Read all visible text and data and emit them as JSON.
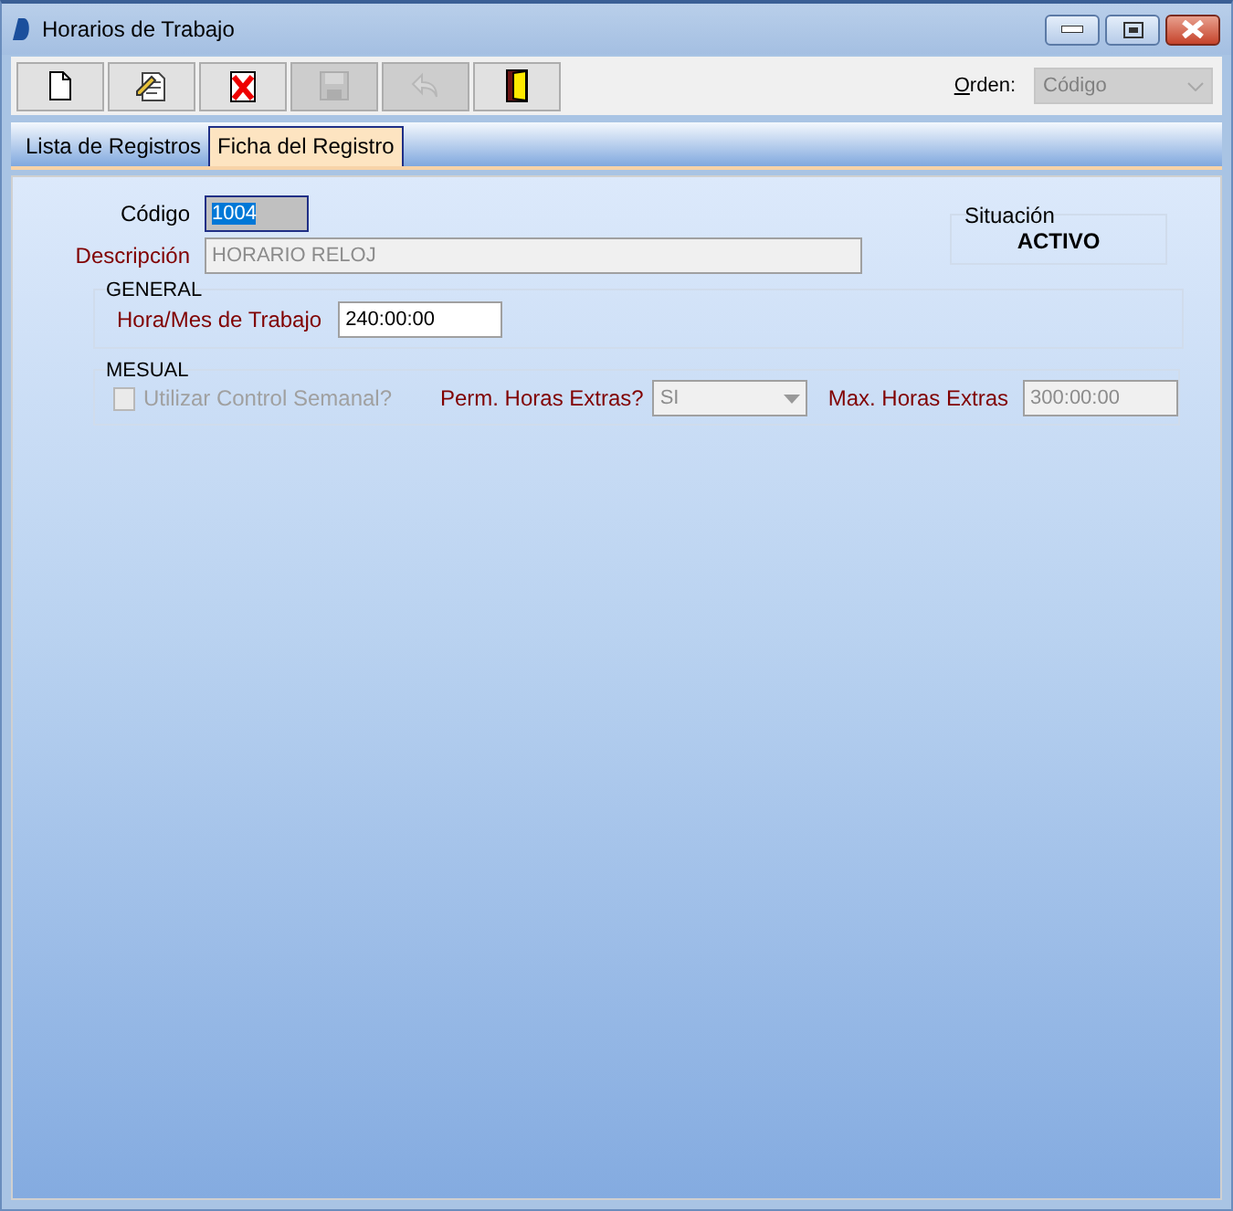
{
  "window": {
    "title": "Horarios de Trabajo"
  },
  "toolbar": {
    "buttons": [
      {
        "kind": "new",
        "disabled": false
      },
      {
        "kind": "edit",
        "disabled": false
      },
      {
        "kind": "delete",
        "disabled": false
      },
      {
        "kind": "save",
        "disabled": true
      },
      {
        "kind": "undo",
        "disabled": true
      },
      {
        "kind": "exit",
        "disabled": false
      }
    ],
    "order": {
      "label": "Orden:",
      "value": "Código",
      "disabled": true
    }
  },
  "tabs": [
    {
      "label": "Lista de Registros",
      "selected": false
    },
    {
      "label": "Ficha del Registro",
      "selected": true
    }
  ],
  "form": {
    "codigo": {
      "label": "Código",
      "value": "1004",
      "selected": true
    },
    "descripcion": {
      "label": "Descripción",
      "value": "HORARIO RELOJ",
      "disabled": true
    },
    "situacion": {
      "label": "Situación",
      "value": "ACTIVO"
    },
    "general": {
      "title": "GENERAL",
      "hours": {
        "label": "Hora/Mes de Trabajo",
        "value": "240:00:00",
        "disabled": false
      }
    },
    "mesual": {
      "title": "MESUAL",
      "weekly": {
        "label": "Utilizar Control Semanal?",
        "checked": false,
        "disabled": true
      },
      "extra": {
        "label": "Perm. Horas Extras?",
        "value": "SI",
        "disabled": true
      },
      "max": {
        "label": "Max. Horas Extras",
        "value": "300:00:00",
        "disabled": true
      }
    }
  }
}
